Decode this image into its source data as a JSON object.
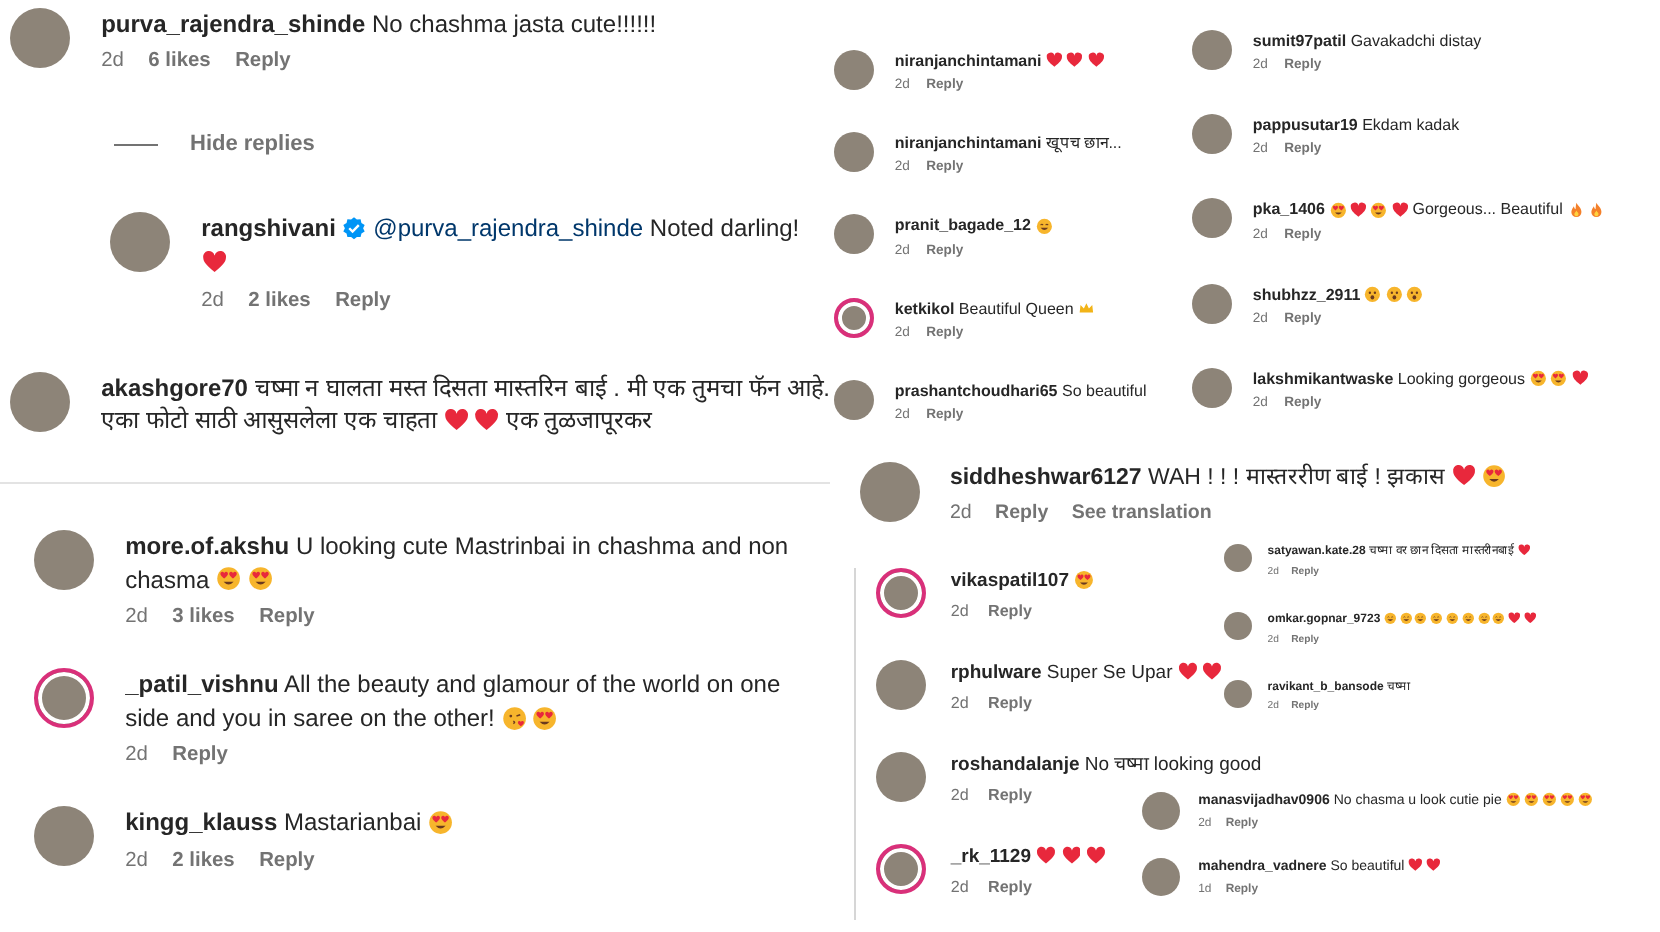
{
  "panels": [
    {
      "comments": [
        {
          "user": "purva_rajendra_shinde",
          "ring": false,
          "body": [
            {
              "kind": "text",
              "text": "No chashma jasta cute!!!!!!"
            }
          ],
          "actions": [
            {
              "kind": "time",
              "text": "2d"
            },
            {
              "kind": "likes",
              "text": "6 likes"
            },
            {
              "kind": "reply",
              "text": "Reply"
            }
          ],
          "replies_toggle": "Hide replies",
          "replies": [
            {
              "user": "rangshivani",
              "ring": false,
              "verified": true,
              "body": [
                {
                  "kind": "mention",
                  "text": "@purva_rajendra_shinde"
                },
                {
                  "kind": "text",
                  "text": "Noted darling!"
                },
                {
                  "kind": "heart"
                }
              ],
              "actions": [
                {
                  "kind": "time",
                  "text": "2d"
                },
                {
                  "kind": "likes",
                  "text": "2 likes"
                },
                {
                  "kind": "reply",
                  "text": "Reply"
                }
              ]
            }
          ]
        },
        {
          "user": "akashgore70",
          "ring": false,
          "body": [
            {
              "kind": "text",
              "text": "चष्मा न घालता मस्त दिसता मास्तरिन बाई . मी एक तुमचा फॅन आहे. एका फोटो साठी आसुसलेला एक चाहता"
            },
            {
              "kind": "heart"
            },
            {
              "kind": "heart"
            },
            {
              "kind": "text",
              "text": "एक तुळजापूरकर"
            }
          ]
        }
      ]
    },
    {
      "comments": [
        {
          "user": "more.of.akshu",
          "ring": false,
          "body": [
            {
              "kind": "text",
              "text": "U looking cute Mastrinbai in chashma and non chasma"
            },
            {
              "kind": "heart-eyes"
            },
            {
              "kind": "heart-eyes"
            }
          ],
          "actions": [
            {
              "kind": "time",
              "text": "2d"
            },
            {
              "kind": "likes",
              "text": "3 likes"
            },
            {
              "kind": "reply",
              "text": "Reply"
            }
          ]
        },
        {
          "user": "_patil_vishnu",
          "ring": true,
          "body": [
            {
              "kind": "text",
              "text": "All the beauty and glamour of the world on one side and you in saree on the other!"
            },
            {
              "kind": "kiss"
            },
            {
              "kind": "heart-eyes"
            }
          ],
          "actions": [
            {
              "kind": "time",
              "text": "2d"
            },
            {
              "kind": "reply",
              "text": "Reply"
            }
          ]
        },
        {
          "user": "kingg_klauss",
          "ring": false,
          "body": [
            {
              "kind": "text",
              "text": "Mastarianbai"
            },
            {
              "kind": "heart-eyes"
            }
          ],
          "actions": [
            {
              "kind": "time",
              "text": "2d"
            },
            {
              "kind": "likes",
              "text": "2 likes"
            },
            {
              "kind": "reply",
              "text": "Reply"
            }
          ]
        }
      ]
    },
    {
      "comments": [
        {
          "user": "niranjanchintamani",
          "ring": false,
          "body": [
            {
              "kind": "heart"
            },
            {
              "kind": "heart"
            },
            {
              "kind": "heart"
            }
          ],
          "actions": [
            {
              "kind": "time",
              "text": "2d"
            },
            {
              "kind": "reply",
              "text": "Reply"
            }
          ]
        },
        {
          "user": "niranjanchintamani",
          "ring": false,
          "body": [
            {
              "kind": "text",
              "text": "खूपच छान..."
            }
          ],
          "actions": [
            {
              "kind": "time",
              "text": "2d"
            },
            {
              "kind": "reply",
              "text": "Reply"
            }
          ]
        },
        {
          "user": "pranit_bagade_12",
          "ring": false,
          "body": [
            {
              "kind": "smile"
            }
          ],
          "actions": [
            {
              "kind": "time",
              "text": "2d"
            },
            {
              "kind": "reply",
              "text": "Reply"
            }
          ]
        },
        {
          "user": "ketkikol",
          "ring": true,
          "body": [
            {
              "kind": "text",
              "text": "Beautiful Queen"
            },
            {
              "kind": "crown"
            }
          ],
          "actions": [
            {
              "kind": "time",
              "text": "2d"
            },
            {
              "kind": "reply",
              "text": "Reply"
            }
          ]
        },
        {
          "user": "prashantchoudhari65",
          "ring": false,
          "body": [
            {
              "kind": "text",
              "text": "So beautiful"
            }
          ],
          "actions": [
            {
              "kind": "time",
              "text": "2d"
            },
            {
              "kind": "reply",
              "text": "Reply"
            }
          ]
        }
      ]
    },
    {
      "comments": [
        {
          "user": "sumit97patil",
          "ring": false,
          "body": [
            {
              "kind": "text",
              "text": "Gavakadchi distay"
            }
          ],
          "actions": [
            {
              "kind": "time",
              "text": "2d"
            },
            {
              "kind": "reply",
              "text": "Reply"
            }
          ]
        },
        {
          "user": "pappusutar19",
          "ring": false,
          "body": [
            {
              "kind": "text",
              "text": "Ekdam kadak"
            }
          ],
          "actions": [
            {
              "kind": "time",
              "text": "2d"
            },
            {
              "kind": "reply",
              "text": "Reply"
            }
          ]
        },
        {
          "user": "pka_1406",
          "ring": false,
          "body": [
            {
              "kind": "heart-eyes"
            },
            {
              "kind": "heart"
            },
            {
              "kind": "heart-eyes"
            },
            {
              "kind": "heart"
            },
            {
              "kind": "text",
              "text": "Gorgeous... Beautiful"
            },
            {
              "kind": "fire"
            },
            {
              "kind": "fire"
            }
          ],
          "actions": [
            {
              "kind": "time",
              "text": "2d"
            },
            {
              "kind": "reply",
              "text": "Reply"
            }
          ]
        },
        {
          "user": "shubhzz_2911",
          "ring": false,
          "body": [
            {
              "kind": "astonished"
            },
            {
              "kind": "astonished"
            },
            {
              "kind": "astonished"
            }
          ],
          "actions": [
            {
              "kind": "time",
              "text": "2d"
            },
            {
              "kind": "reply",
              "text": "Reply"
            }
          ]
        },
        {
          "user": "lakshmikantwaske",
          "ring": false,
          "body": [
            {
              "kind": "text",
              "text": "Looking gorgeous"
            },
            {
              "kind": "heart-eyes"
            },
            {
              "kind": "heart-eyes"
            },
            {
              "kind": "heart"
            }
          ],
          "actions": [
            {
              "kind": "time",
              "text": "2d"
            },
            {
              "kind": "reply",
              "text": "Reply"
            }
          ]
        }
      ]
    },
    {
      "comments": [
        {
          "user": "siddheshwar6127",
          "ring": false,
          "body": [
            {
              "kind": "text",
              "text": "WAH ! ! ! मास्तररीण बाई ! झकास"
            },
            {
              "kind": "heart"
            },
            {
              "kind": "heart-eyes"
            }
          ],
          "actions": [
            {
              "kind": "time",
              "text": "2d"
            },
            {
              "kind": "reply",
              "text": "Reply"
            },
            {
              "kind": "translate",
              "text": "See translation"
            }
          ]
        }
      ]
    },
    {
      "comments": [
        {
          "user": "vikaspatil107",
          "ring": true,
          "body": [
            {
              "kind": "heart-eyes"
            }
          ],
          "actions": [
            {
              "kind": "time",
              "text": "2d"
            },
            {
              "kind": "reply",
              "text": "Reply"
            }
          ]
        },
        {
          "user": "rphulware",
          "ring": false,
          "body": [
            {
              "kind": "text",
              "text": "Super Se Upar"
            },
            {
              "kind": "heart"
            },
            {
              "kind": "heart"
            }
          ],
          "actions": [
            {
              "kind": "time",
              "text": "2d"
            },
            {
              "kind": "reply",
              "text": "Reply"
            }
          ]
        },
        {
          "user": "roshandalanje",
          "ring": false,
          "body": [
            {
              "kind": "text",
              "text": "No चष्मा looking good"
            }
          ],
          "actions": [
            {
              "kind": "time",
              "text": "2d"
            },
            {
              "kind": "reply",
              "text": "Reply"
            }
          ]
        },
        {
          "user": "_rk_1129",
          "ring": true,
          "body": [
            {
              "kind": "heart"
            },
            {
              "kind": "heart"
            },
            {
              "kind": "heart"
            }
          ],
          "actions": [
            {
              "kind": "time",
              "text": "2d"
            },
            {
              "kind": "reply",
              "text": "Reply"
            }
          ]
        }
      ]
    },
    {
      "comments": [
        {
          "user": "satyawan.kate.28",
          "ring": false,
          "body": [
            {
              "kind": "text",
              "text": "चष्मा वर छान दिसता मास्तरीनबाई"
            },
            {
              "kind": "heart"
            }
          ],
          "actions": [
            {
              "kind": "time",
              "text": "2d"
            },
            {
              "kind": "reply",
              "text": "Reply"
            }
          ]
        },
        {
          "user": "omkar.gopnar_9723",
          "ring": false,
          "body": [
            {
              "kind": "smile"
            },
            {
              "kind": "smile"
            },
            {
              "kind": "smile"
            },
            {
              "kind": "smile"
            },
            {
              "kind": "smile"
            },
            {
              "kind": "smile"
            },
            {
              "kind": "smile"
            },
            {
              "kind": "smile"
            },
            {
              "kind": "heart"
            },
            {
              "kind": "heart"
            }
          ],
          "actions": [
            {
              "kind": "time",
              "text": "2d"
            },
            {
              "kind": "reply",
              "text": "Reply"
            }
          ]
        },
        {
          "user": "ravikant_b_bansode",
          "ring": false,
          "body": [
            {
              "kind": "text",
              "text": "चष्मा"
            }
          ],
          "actions": [
            {
              "kind": "time",
              "text": "2d"
            },
            {
              "kind": "reply",
              "text": "Reply"
            }
          ]
        }
      ]
    },
    {
      "comments": [
        {
          "user": "manasvijadhav0906",
          "ring": false,
          "body": [
            {
              "kind": "text",
              "text": "No chasma u look cutie pie"
            },
            {
              "kind": "heart-eyes"
            },
            {
              "kind": "heart-eyes"
            },
            {
              "kind": "heart-eyes"
            },
            {
              "kind": "heart-eyes"
            },
            {
              "kind": "heart-eyes"
            }
          ],
          "actions": [
            {
              "kind": "time",
              "text": "2d"
            },
            {
              "kind": "reply",
              "text": "Reply"
            }
          ]
        },
        {
          "user": "mahendra_vadnere",
          "ring": false,
          "body": [
            {
              "kind": "text",
              "text": "So beautiful"
            },
            {
              "kind": "heart"
            },
            {
              "kind": "heart"
            }
          ],
          "actions": [
            {
              "kind": "time",
              "text": "1d"
            },
            {
              "kind": "reply",
              "text": "Reply"
            }
          ]
        }
      ]
    }
  ]
}
